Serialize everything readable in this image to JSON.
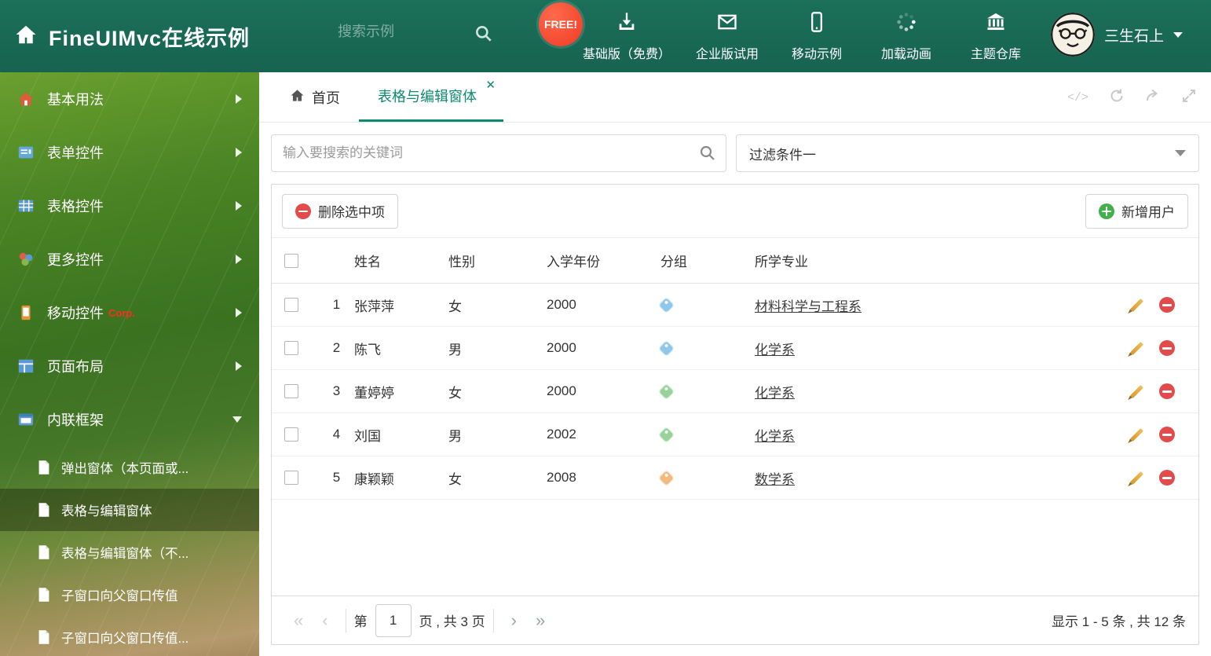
{
  "colors": {
    "header_bg": "#1b7059",
    "accent_teal": "#0e8a6d",
    "free_badge_red": "#ef3a23",
    "tag_blue": "#8fc7ea",
    "tag_green": "#97d398",
    "tag_orange": "#f3b87e",
    "delete_red": "#e14b4b",
    "add_green": "#43b14b"
  },
  "header": {
    "title": "FineUIMvc在线示例",
    "search_placeholder": "搜索示例",
    "free_badge": "FREE!",
    "nav_items": [
      {
        "label": "基础版（免费）",
        "icon": "download-icon"
      },
      {
        "label": "企业版试用",
        "icon": "mail-icon"
      },
      {
        "label": "移动示例",
        "icon": "mobile-icon"
      },
      {
        "label": "加载动画",
        "icon": "spinner-icon"
      },
      {
        "label": "主题仓库",
        "icon": "bank-icon"
      }
    ],
    "username": "三生石上"
  },
  "sidebar": {
    "items": [
      {
        "label": "基本用法",
        "icon": "home-icon"
      },
      {
        "label": "表单控件",
        "icon": "form-icon"
      },
      {
        "label": "表格控件",
        "icon": "table-icon"
      },
      {
        "label": "更多控件",
        "icon": "widgets-icon"
      },
      {
        "label": "移动控件",
        "icon": "mobile-icon",
        "badge": "Corp."
      },
      {
        "label": "页面布局",
        "icon": "layout-icon"
      },
      {
        "label": "内联框架",
        "icon": "iframe-icon"
      }
    ],
    "subitems": [
      {
        "label": "弹出窗体（本页面或..."
      },
      {
        "label": "表格与编辑窗体"
      },
      {
        "label": "表格与编辑窗体（不..."
      },
      {
        "label": "子窗口向父窗口传值"
      },
      {
        "label": "子窗口向父窗口传值..."
      }
    ]
  },
  "tabbar": {
    "home_tab": "首页",
    "active_tab": "表格与编辑窗体",
    "code_icon_text": "</>"
  },
  "filter_row": {
    "search_placeholder": "输入要搜索的关键词",
    "filter_selected": "过滤条件一"
  },
  "toolbar": {
    "delete_button": "删除选中项",
    "add_button": "新增用户"
  },
  "table": {
    "columns": [
      "姓名",
      "性别",
      "入学年份",
      "分组",
      "所学专业"
    ],
    "rows": [
      {
        "num": "1",
        "name": "张萍萍",
        "gender": "女",
        "year": "2000",
        "tag_color": "#8fc7ea",
        "major": "材料科学与工程系"
      },
      {
        "num": "2",
        "name": "陈飞",
        "gender": "男",
        "year": "2000",
        "tag_color": "#8fc7ea",
        "major": "化学系"
      },
      {
        "num": "3",
        "name": "董婷婷",
        "gender": "女",
        "year": "2000",
        "tag_color": "#97d398",
        "major": "化学系"
      },
      {
        "num": "4",
        "name": "刘国",
        "gender": "男",
        "year": "2002",
        "tag_color": "#97d398",
        "major": "化学系"
      },
      {
        "num": "5",
        "name": "康颖颖",
        "gender": "女",
        "year": "2008",
        "tag_color": "#f3b87e",
        "major": "数学系"
      }
    ]
  },
  "pagination": {
    "label_prefix": "第",
    "current_page": "1",
    "label_suffix": "页 , 共 3 页",
    "summary": "显示 1 - 5 条 , 共 12 条"
  }
}
